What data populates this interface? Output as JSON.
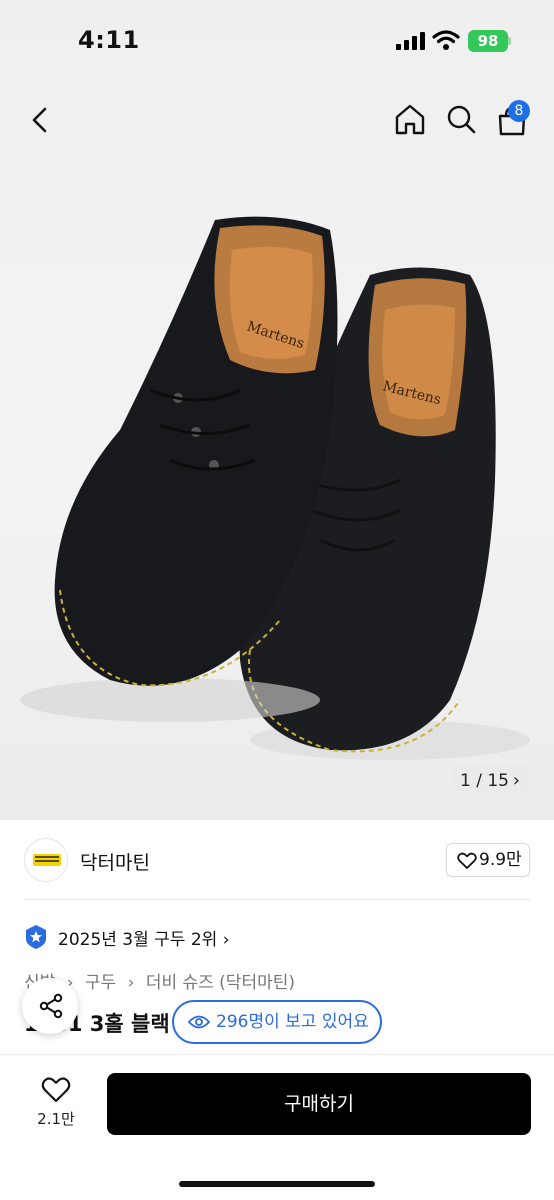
{
  "status_bar": {
    "time": "4:11",
    "battery": "98"
  },
  "nav": {
    "cart_count": "8"
  },
  "gallery": {
    "counter": "1 / 15",
    "chevron": "›"
  },
  "brand": {
    "name": "닥터마틴",
    "likes": "9.9만"
  },
  "ranking": {
    "text": "2025년 3월 구두 2위",
    "chevron": "›"
  },
  "breadcrumb": {
    "items": [
      "신발",
      "›",
      "구두",
      "›",
      "더비 슈즈 (닥터마틴)"
    ]
  },
  "product": {
    "title_visible": "1461 3홀 블랙"
  },
  "viewers_pill": {
    "text": "296명이 보고 있어요"
  },
  "bottom": {
    "wish_count": "2.1만",
    "buy_label": "구매하기"
  },
  "colors": {
    "accent": "#2c6be0",
    "badge": "#1e6fe6",
    "battery": "#34c759",
    "buy_button": "#000000"
  },
  "icons": [
    "back-icon",
    "home-icon",
    "search-icon",
    "cart-icon",
    "heart-icon",
    "ranking-star-icon",
    "eye-icon",
    "share-icon"
  ]
}
